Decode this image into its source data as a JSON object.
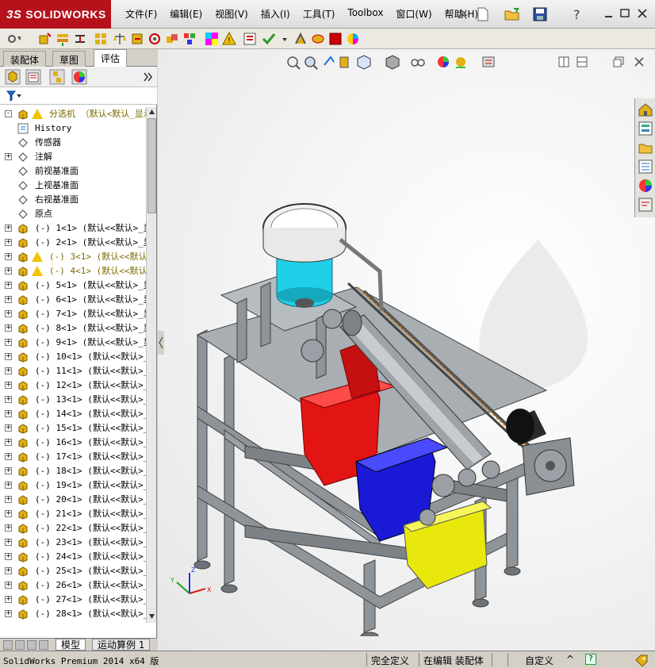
{
  "menu": {
    "brand": "SOLIDWORKS",
    "brand_prefix": "3S",
    "items": [
      "文件(F)",
      "编辑(E)",
      "视图(V)",
      "插入(I)",
      "工具(T)",
      "Toolbox",
      "窗口(W)",
      "帮助(H)"
    ]
  },
  "left_panel": {
    "tabs": [
      "装配体",
      "草图",
      "评估"
    ],
    "active_tab": "评估",
    "tree": [
      {
        "label": "分选机 （默认<默认_显示",
        "warning": true,
        "top": true
      },
      {
        "label": "History",
        "mono": true
      },
      {
        "label": "传感器"
      },
      {
        "label": "注解",
        "expand": true
      },
      {
        "label": "前视基准面"
      },
      {
        "label": "上视基准面"
      },
      {
        "label": "右视基准面"
      },
      {
        "label": "原点"
      },
      {
        "label": "(-) 1<1> (默认<<默认>_显",
        "part": true
      },
      {
        "label": "(-) 2<1> (默认<<默认>_显",
        "part": true
      },
      {
        "label": "(-) 3<1> (默认<<默认",
        "part": true,
        "warning": true
      },
      {
        "label": "(-) 4<1> (默认<<默认",
        "part": true,
        "warning": true
      },
      {
        "label": "(-) 5<1> (默认<<默认>_显",
        "part": true
      },
      {
        "label": "(-) 6<1> (默认<<默认>_显",
        "part": true
      },
      {
        "label": "(-) 7<1> (默认<<默认>_显",
        "part": true
      },
      {
        "label": "(-) 8<1> (默认<<默认>_显",
        "part": true
      },
      {
        "label": "(-) 9<1> (默认<<默认>_显",
        "part": true
      },
      {
        "label": "(-) 10<1> (默认<<默认>_",
        "part": true
      },
      {
        "label": "(-) 11<1> (默认<<默认>_",
        "part": true
      },
      {
        "label": "(-) 12<1> (默认<<默认>_",
        "part": true
      },
      {
        "label": "(-) 13<1> (默认<<默认>_",
        "part": true
      },
      {
        "label": "(-) 14<1> (默认<<默认>_",
        "part": true
      },
      {
        "label": "(-) 15<1> (默认<<默认>_",
        "part": true
      },
      {
        "label": "(-) 16<1> (默认<<默认>_",
        "part": true
      },
      {
        "label": "(-) 17<1> (默认<<默认>_",
        "part": true
      },
      {
        "label": "(-) 18<1> (默认<<默认>_",
        "part": true
      },
      {
        "label": "(-) 19<1> (默认<<默认>_",
        "part": true
      },
      {
        "label": "(-) 20<1> (默认<<默认>_",
        "part": true
      },
      {
        "label": "(-) 21<1> (默认<<默认>_",
        "part": true
      },
      {
        "label": "(-) 22<1> (默认<<默认>_",
        "part": true
      },
      {
        "label": "(-) 23<1> (默认<<默认>_",
        "part": true
      },
      {
        "label": "(-) 24<1> (默认<<默认>_",
        "part": true
      },
      {
        "label": "(-) 25<1> (默认<<默认>_",
        "part": true
      },
      {
        "label": "(-) 26<1> (默认<<默认>_",
        "part": true
      },
      {
        "label": "(-) 27<1> (默认<<默认>_",
        "part": true
      },
      {
        "label": "(-) 28<1> (默认<<默认>_",
        "part": true
      }
    ],
    "bottom_tabs": [
      "模型",
      "运动算例 1"
    ]
  },
  "status": {
    "app": "SolidWorks Premium 2014 x64 版",
    "state": "完全定义",
    "mode": "在编辑 装配体",
    "units": "自定义",
    "units_arrow": "^",
    "help": "?"
  },
  "colors": {
    "brand": "#b5121b",
    "frame": "#8f9499",
    "frame_dark": "#6e7378",
    "bin_red": "#e31414",
    "bin_blue": "#1a1ad6",
    "bin_yellow": "#e8e80c",
    "bowl_cyan": "#1fd0e8",
    "axis_x": "#d81818",
    "axis_y": "#1ba11b",
    "axis_z": "#1a3ad8"
  },
  "axis_labels": {
    "x": "X",
    "y": "Y",
    "z": "Z"
  }
}
